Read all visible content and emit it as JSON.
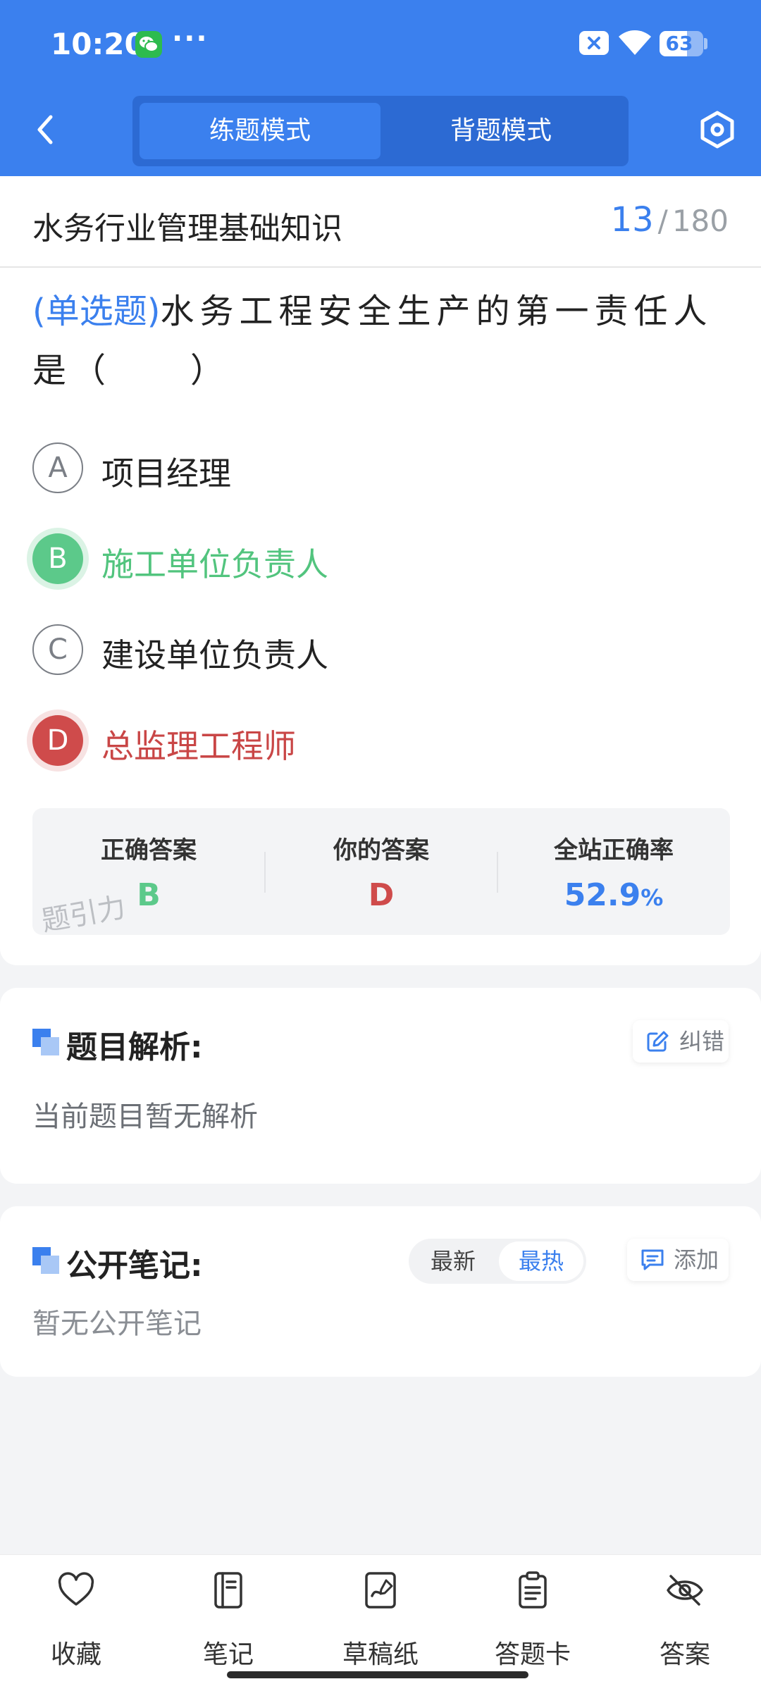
{
  "status_bar": {
    "time": "10:20",
    "battery": "63",
    "battery_level": 0.63
  },
  "header": {
    "mode_practice": "练题模式",
    "mode_memorize": "背题模式"
  },
  "question_card": {
    "subject": "水务行业管理基础知识",
    "current": "13",
    "separator": "/",
    "total": "180",
    "question_type": "(单选题)",
    "question_text": "水务工程安全生产的第一责任人是（　　）",
    "options": [
      {
        "letter": "A",
        "text": "项目经理",
        "state": "normal"
      },
      {
        "letter": "B",
        "text": "施工单位负责人",
        "state": "correct"
      },
      {
        "letter": "C",
        "text": "建设单位负责人",
        "state": "normal"
      },
      {
        "letter": "D",
        "text": "总监理工程师",
        "state": "wrong"
      }
    ],
    "answer_summary": {
      "correct_label": "正确答案",
      "correct_value": "B",
      "yours_label": "你的答案",
      "yours_value": "D",
      "rate_label": "全站正确率",
      "rate_value": "52.9",
      "rate_unit": "%",
      "watermark": "题引力"
    }
  },
  "analysis": {
    "title": "题目解析:",
    "correct_button": "纠错",
    "empty": "当前题目暂无解析"
  },
  "notes": {
    "title": "公开笔记:",
    "sort_latest": "最新",
    "sort_hot": "最热",
    "add_button": "添加",
    "empty": "暂无公开笔记"
  },
  "bottom_nav": [
    {
      "label": "收藏",
      "icon": "heart-icon"
    },
    {
      "label": "笔记",
      "icon": "notebook-icon"
    },
    {
      "label": "草稿纸",
      "icon": "draft-icon"
    },
    {
      "label": "答题卡",
      "icon": "answer-card-icon"
    },
    {
      "label": "答案",
      "icon": "eye-off-icon"
    }
  ],
  "colors": {
    "brand": "#3b80ee",
    "correct": "#5cc98a",
    "wrong": "#cf4b4b"
  }
}
